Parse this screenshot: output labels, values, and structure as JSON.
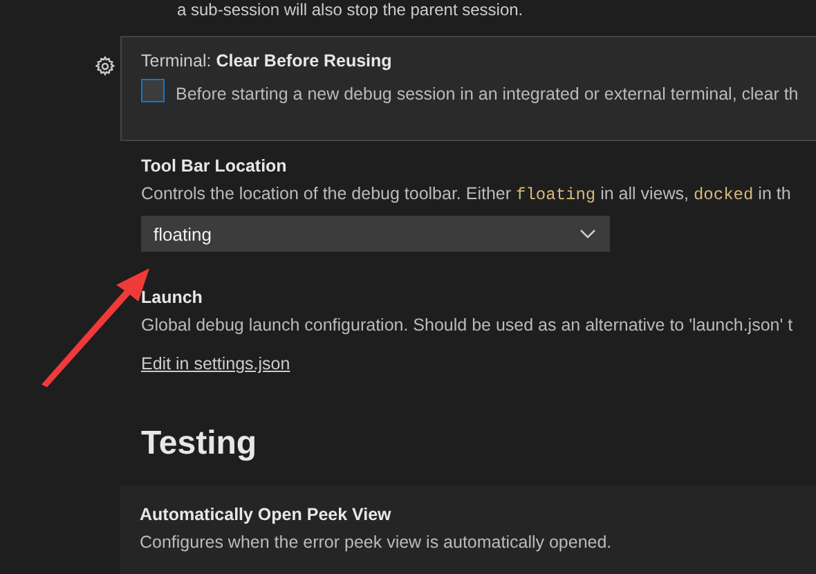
{
  "top_text": "a sub-session will also stop the parent session.",
  "settings": [
    {
      "kind": "checkbox",
      "focused": true,
      "category": "Terminal: ",
      "title": "Clear Before Reusing",
      "checked": false,
      "description": [
        {
          "kind": "text",
          "text": "Before starting a new debug session in an integrated or external terminal, clear th"
        }
      ]
    },
    {
      "kind": "select",
      "focused": false,
      "title": "Tool Bar Location",
      "description": [
        {
          "kind": "text",
          "text": "Controls the location of the debug toolbar. Either "
        },
        {
          "kind": "code",
          "text": "floating"
        },
        {
          "kind": "text",
          "text": " in all views, "
        },
        {
          "kind": "code",
          "text": "docked"
        },
        {
          "kind": "text",
          "text": " in th"
        }
      ],
      "value": "floating"
    },
    {
      "kind": "link",
      "focused": false,
      "title": "Launch",
      "description": [
        {
          "kind": "text",
          "text": "Global debug launch configuration. Should be used as an alternative to 'launch.json' t"
        }
      ],
      "link": "Edit in settings.json"
    }
  ],
  "section": {
    "title": "Testing",
    "items": [
      {
        "title": "Automatically Open Peek View",
        "description": "Configures when the error peek view is automatically opened."
      }
    ]
  }
}
